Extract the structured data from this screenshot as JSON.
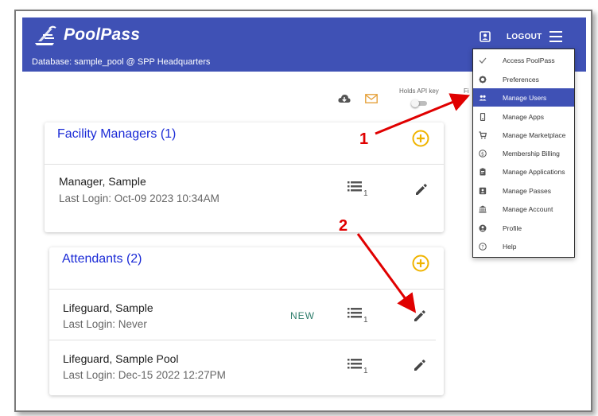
{
  "app": {
    "name": "PoolPass",
    "database_line": "Database: sample_pool @ SPP Headquarters",
    "logout_label": "LOGOUT",
    "brand_color": "#3f51b5"
  },
  "toolbar": {
    "holds_api_key_label": "Holds API key",
    "cut_label": "Fi",
    "icons": [
      "cloud-download-icon",
      "email-icon"
    ]
  },
  "facility_managers": {
    "title": "Facility Managers (1)",
    "rows": [
      {
        "name": "Manager, Sample",
        "last_login": "Last Login: Oct-09 2023 10:34AM",
        "count": "1",
        "badge": ""
      }
    ]
  },
  "attendants": {
    "title": "Attendants (2)",
    "rows": [
      {
        "name": "Lifeguard, Sample",
        "last_login": "Last Login: Never",
        "count": "1",
        "badge": "NEW"
      },
      {
        "name": "Lifeguard, Sample Pool",
        "last_login": "Last Login: Dec-15 2022 12:27PM",
        "count": "1",
        "badge": ""
      }
    ]
  },
  "menu": {
    "items": [
      {
        "label": "Access PoolPass",
        "icon": "check-icon"
      },
      {
        "label": "Preferences",
        "icon": "gear-icon"
      },
      {
        "label": "Manage Users",
        "icon": "users-icon",
        "active": true
      },
      {
        "label": "Manage Apps",
        "icon": "phone-icon"
      },
      {
        "label": "Manage Marketplace",
        "icon": "cart-icon"
      },
      {
        "label": "Membership Billing",
        "icon": "dollar-icon"
      },
      {
        "label": "Manage Applications",
        "icon": "clipboard-icon"
      },
      {
        "label": "Manage Passes",
        "icon": "id-card-icon"
      },
      {
        "label": "Manage Account",
        "icon": "bank-icon"
      },
      {
        "label": "Profile",
        "icon": "account-circle-icon"
      },
      {
        "label": "Help",
        "icon": "help-icon"
      }
    ],
    "active_color": "#3f51b5"
  },
  "annotations": {
    "step1": "1",
    "step2": "2",
    "color": "#e00000"
  }
}
